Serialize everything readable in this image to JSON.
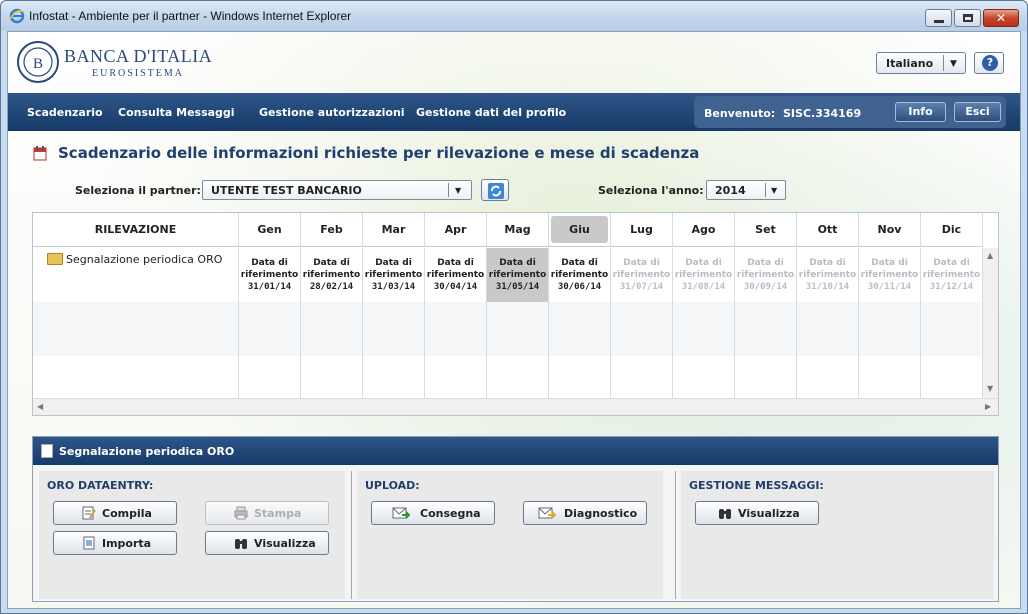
{
  "window": {
    "title": "Infostat - Ambiente per il partner - Windows Internet Explorer"
  },
  "header": {
    "brand_line1": "BANCA D'ITALIA",
    "brand_line2": "EUROSISTEMA",
    "language": "Italiano",
    "help_label": "?"
  },
  "nav": {
    "items": [
      "Scadenzario",
      "Consulta Messaggi",
      "Gestione autorizzazioni",
      "Gestione dati del profilo"
    ],
    "welcome_label": "Benvenuto:",
    "user": "SISC.334169",
    "info_label": "Info",
    "exit_label": "Esci"
  },
  "page": {
    "title": "Scadenzario delle informazioni richieste per rilevazione e mese di scadenza",
    "partner_label": "Seleziona il partner:",
    "partner_value": "UTENTE TEST BANCARIO",
    "year_label": "Seleziona l'anno:",
    "year_value": "2014"
  },
  "grid": {
    "col_header": "RILEVAZIONE",
    "months": [
      "Gen",
      "Feb",
      "Mar",
      "Apr",
      "Mag",
      "Giu",
      "Lug",
      "Ago",
      "Set",
      "Ott",
      "Nov",
      "Dic"
    ],
    "current_month_index": 5,
    "rows": [
      {
        "name": "Segnalazione periodica ORO",
        "cells": [
          {
            "l1": "Data di",
            "l2": "riferimento",
            "date": "31/01/14",
            "state": "active"
          },
          {
            "l1": "Data di",
            "l2": "riferimento",
            "date": "28/02/14",
            "state": "active"
          },
          {
            "l1": "Data di",
            "l2": "riferimento",
            "date": "31/03/14",
            "state": "active"
          },
          {
            "l1": "Data di",
            "l2": "riferimento",
            "date": "30/04/14",
            "state": "active"
          },
          {
            "l1": "Data di",
            "l2": "riferimento",
            "date": "31/05/14",
            "state": "selected"
          },
          {
            "l1": "Data di",
            "l2": "riferimento",
            "date": "30/06/14",
            "state": "active"
          },
          {
            "l1": "Data di",
            "l2": "riferimento",
            "date": "31/07/14",
            "state": "dim"
          },
          {
            "l1": "Data di",
            "l2": "riferimento",
            "date": "31/08/14",
            "state": "dim"
          },
          {
            "l1": "Data di",
            "l2": "riferimento",
            "date": "30/09/14",
            "state": "dim"
          },
          {
            "l1": "Data di",
            "l2": "riferimento",
            "date": "31/10/14",
            "state": "dim"
          },
          {
            "l1": "Data di",
            "l2": "riferimento",
            "date": "30/11/14",
            "state": "dim"
          },
          {
            "l1": "Data di",
            "l2": "riferimento",
            "date": "31/12/14",
            "state": "dim"
          }
        ]
      }
    ]
  },
  "detail": {
    "title": "Segnalazione periodica ORO",
    "sections": {
      "dataentry": {
        "title": "ORO DATAENTRY:",
        "compila": "Compila",
        "stampa": "Stampa",
        "importa": "Importa",
        "visualizza": "Visualizza"
      },
      "upload": {
        "title": "UPLOAD:",
        "consegna": "Consegna",
        "diagnostico": "Diagnostico"
      },
      "messaggi": {
        "title": "GESTIONE MESSAGGI:",
        "visualizza": "Visualizza"
      }
    }
  },
  "colors": {
    "nav_bg": "#1f4676",
    "title_blue": "#1f3f6e",
    "selected_cell": "#c9c9c9",
    "dim_text": "#b7bdc3"
  }
}
